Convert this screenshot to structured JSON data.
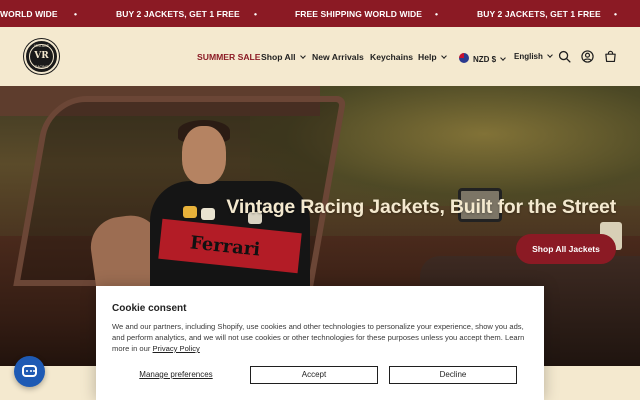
{
  "announcement": {
    "items": [
      "WORLD WIDE",
      "BUY 2 JACKETS, GET 1 FREE",
      "FREE SHIPPING WORLD WIDE",
      "BUY 2 JACKETS, GET 1 FREE"
    ],
    "separator": "•"
  },
  "header": {
    "logo": {
      "top_text": "VINTAGE",
      "monogram": "VR",
      "bottom_text": "RACING"
    },
    "nav": {
      "sale": "SUMMER SALE",
      "shop_all": "Shop All",
      "new_arrivals": "New Arrivals",
      "keychains": "Keychains",
      "help": "Help"
    },
    "currency": "NZD $",
    "language": "English"
  },
  "hero": {
    "title": "Vintage Racing Jackets, Built for the Street",
    "cta": "Shop All Jackets",
    "jacket_text": "Ferrari"
  },
  "cookie": {
    "title": "Cookie consent",
    "body": "We and our partners, including Shopify, use cookies and other technologies to personalize your experience, show you ads, and perform analytics, and we will not use cookies or other technologies for these purposes unless you accept them. Learn more in our",
    "privacy_link": "Privacy Policy",
    "manage": "Manage preferences",
    "accept": "Accept",
    "decline": "Decline"
  },
  "colors": {
    "brand_red": "#8b1a24",
    "cream": "#f4e9cf",
    "chat_blue": "#1e5ab4"
  }
}
